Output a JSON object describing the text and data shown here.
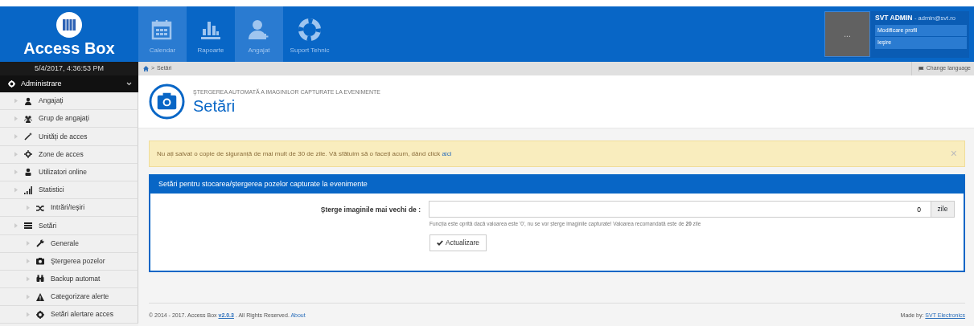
{
  "brand": {
    "name": "Access Box"
  },
  "top_nav": [
    {
      "label": "Calendar",
      "highlighted": true
    },
    {
      "label": "Rapoarte",
      "highlighted": false
    },
    {
      "label": "Angajat",
      "highlighted": true
    },
    {
      "label": "Suport Tehnic",
      "highlighted": false
    }
  ],
  "user": {
    "name": "SVT ADMIN",
    "email": "- admin@svt.ro",
    "avatar_text": "...",
    "links": [
      "Modificare profil",
      "Ieşire"
    ]
  },
  "sidebar": {
    "datetime": "5/4/2017, 4:36:53 PM",
    "section": {
      "label": "Administrare",
      "expanded": true
    },
    "items": [
      {
        "label": "Angajați"
      },
      {
        "label": "Grup de angajați"
      },
      {
        "label": "Unități de acces"
      },
      {
        "label": "Zone de acces"
      },
      {
        "label": "Utilizatori online"
      },
      {
        "label": "Statistici",
        "children": [
          {
            "label": "Intrări/Ieşiri"
          }
        ]
      },
      {
        "label": "Setări",
        "children": [
          {
            "label": "Generale"
          },
          {
            "label": "Ştergerea pozelor"
          },
          {
            "label": "Backup automat"
          },
          {
            "label": "Categorizare alerte"
          },
          {
            "label": "Setări alertare acces"
          }
        ]
      }
    ]
  },
  "breadcrumb": {
    "separator": ">",
    "current": "Setări",
    "language": "Change language"
  },
  "page_header": {
    "subtitle": "ŞTERGEREA AUTOMATĂ A IMAGINILOR CAPTURATE LA EVENIMENTE",
    "title": "Setări"
  },
  "alert": {
    "text": "Nu ați salvat o copie de siguranță de mai mult de 30 de zile. Vă sfătuim să o faceți acum, dând click ",
    "link": "aici",
    "close": "×"
  },
  "panel": {
    "title": "Setări pentru stocarea/ștergerea pozelor capturate la evenimente",
    "field_label": "Șterge imaginile mai vechi de :",
    "value": "0",
    "unit": "zile",
    "help": "Funcția este oprită dacă valoarea este '0', nu se vor șterge imaginile capturate! Valoarea recomandată este de **20** zile",
    "button": "Actualizare"
  },
  "footer": {
    "copyright": "© 2014 - 2017. Access Box",
    "version": "v2.0.3",
    "rights": ". All Rights Reserved.",
    "about": "About",
    "made_by": "Made by:",
    "company": "SVT Electronics"
  }
}
